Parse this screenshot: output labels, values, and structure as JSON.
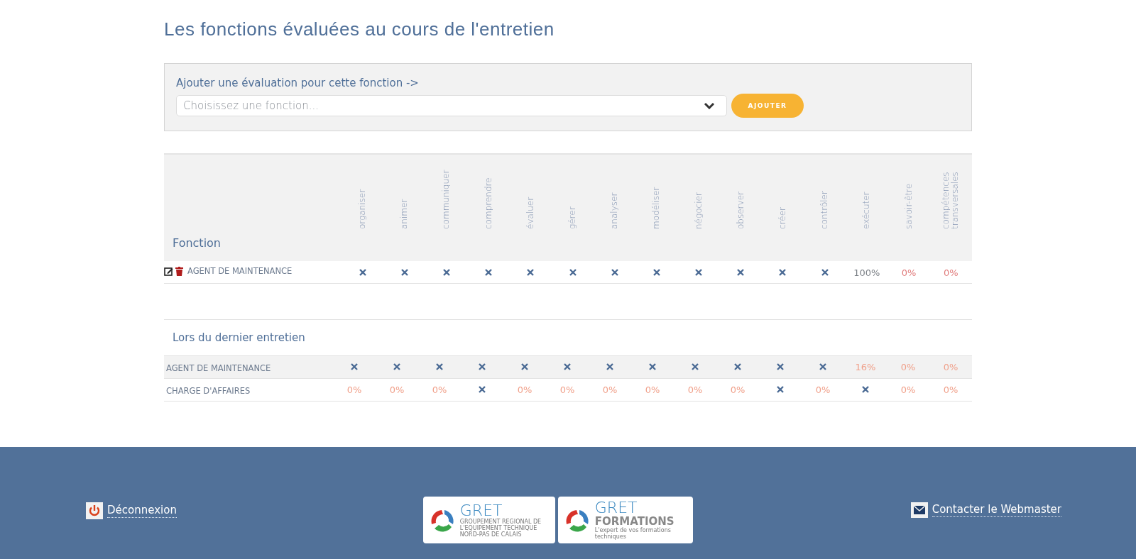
{
  "page_title": "Les fonctions évaluées au cours de l'entretien",
  "add_panel": {
    "label": "Ajouter une évaluation pour cette fonction ->",
    "select": {
      "placeholder": "Choisissez une fonction..."
    },
    "button": "AJOUTER"
  },
  "table": {
    "first_column": "Fonction",
    "columns": [
      "organiser",
      "animer",
      "communiquer",
      "comprendre",
      "évaluer",
      "gérer",
      "analyser",
      "modéliser",
      "négocier",
      "observer",
      "créer",
      "contrôler",
      "exécuter",
      "savoir-être",
      "compétences transversales"
    ],
    "rows": [
      {
        "name": "AGENT DE MAINTENANCE",
        "cells": [
          {
            "kind": "cross"
          },
          {
            "kind": "cross"
          },
          {
            "kind": "cross"
          },
          {
            "kind": "cross"
          },
          {
            "kind": "cross"
          },
          {
            "kind": "cross"
          },
          {
            "kind": "cross"
          },
          {
            "kind": "cross"
          },
          {
            "kind": "cross"
          },
          {
            "kind": "cross"
          },
          {
            "kind": "cross"
          },
          {
            "kind": "cross"
          },
          {
            "kind": "percent",
            "text": "100%",
            "color": "#7a7f85"
          },
          {
            "kind": "percent",
            "text": "0%",
            "color": "#e07a7a"
          },
          {
            "kind": "percent",
            "text": "0%",
            "color": "#e07a7a"
          }
        ]
      }
    ]
  },
  "previous": {
    "title": "Lors du dernier entretien",
    "rows": [
      {
        "name": "AGENT DE MAINTENANCE",
        "cells": [
          {
            "kind": "cross"
          },
          {
            "kind": "cross"
          },
          {
            "kind": "cross"
          },
          {
            "kind": "cross"
          },
          {
            "kind": "cross"
          },
          {
            "kind": "cross"
          },
          {
            "kind": "cross"
          },
          {
            "kind": "cross"
          },
          {
            "kind": "cross"
          },
          {
            "kind": "cross"
          },
          {
            "kind": "cross"
          },
          {
            "kind": "cross"
          },
          {
            "kind": "percent",
            "text": "16%",
            "color": "#f0a08a"
          },
          {
            "kind": "percent",
            "text": "0%",
            "color": "#f0a08a"
          },
          {
            "kind": "percent",
            "text": "0%",
            "color": "#f0a08a"
          }
        ]
      },
      {
        "name": "CHARGE D'AFFAIRES",
        "cells": [
          {
            "kind": "percent",
            "text": "0%",
            "color": "#f0a08a"
          },
          {
            "kind": "percent",
            "text": "0%",
            "color": "#f0a08a"
          },
          {
            "kind": "percent",
            "text": "0%",
            "color": "#f0a08a"
          },
          {
            "kind": "cross"
          },
          {
            "kind": "percent",
            "text": "0%",
            "color": "#f0a08a"
          },
          {
            "kind": "percent",
            "text": "0%",
            "color": "#f0a08a"
          },
          {
            "kind": "percent",
            "text": "0%",
            "color": "#f0a08a"
          },
          {
            "kind": "percent",
            "text": "0%",
            "color": "#f0a08a"
          },
          {
            "kind": "percent",
            "text": "0%",
            "color": "#f0a08a"
          },
          {
            "kind": "percent",
            "text": "0%",
            "color": "#f0a08a"
          },
          {
            "kind": "cross"
          },
          {
            "kind": "percent",
            "text": "0%",
            "color": "#f0a08a"
          },
          {
            "kind": "cross"
          },
          {
            "kind": "percent",
            "text": "0%",
            "color": "#f0a08a"
          },
          {
            "kind": "percent",
            "text": "0%",
            "color": "#f0a08a"
          }
        ]
      }
    ]
  },
  "footer": {
    "logout": "Déconnexion",
    "logos": [
      {
        "name": "GRET",
        "subtitle": "GROUPEMENT REGIONAL DE L'EQUIPEMENT TECHNIQUE NORD-PAS DE CALAIS"
      },
      {
        "name": "GRET",
        "name_2": "FORMATIONS",
        "subtitle": "L'expert de vos formations techniques"
      }
    ],
    "contact": "Contacter le Webmaster"
  }
}
